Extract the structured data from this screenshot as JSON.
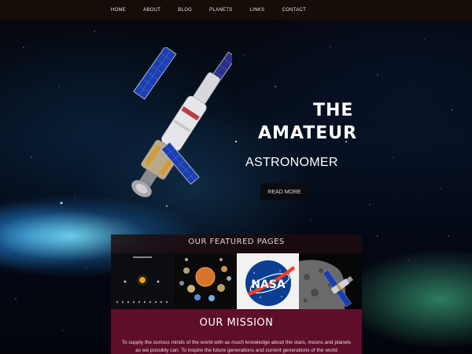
{
  "nav": {
    "items": [
      "HOME",
      "ABOUT",
      "BLOG",
      "PLANETS",
      "LINKS",
      "CONTACT"
    ]
  },
  "hero": {
    "line1": "THE",
    "line2": "AMATEUR",
    "line3": "ASTRONOMER",
    "button_label": "READ MORE"
  },
  "featured": {
    "title": "OUR FEATURED PAGES",
    "thumbnails": [
      "solar-system-diagram",
      "planets-lineup",
      "nasa-logo",
      "spacecraft-over-moon"
    ],
    "nasa_text": "NASA"
  },
  "mission": {
    "title": "OUR MISSION",
    "text": "To supply the curious minds of the world with as much knowledge about the stars, moons and planets as we possibly can. To inspire the future generations and current generations of the world"
  },
  "colors": {
    "nav_bg": "#160c08",
    "mission_bg": "#5e0d2b",
    "button_bg": "#0a0c10"
  }
}
